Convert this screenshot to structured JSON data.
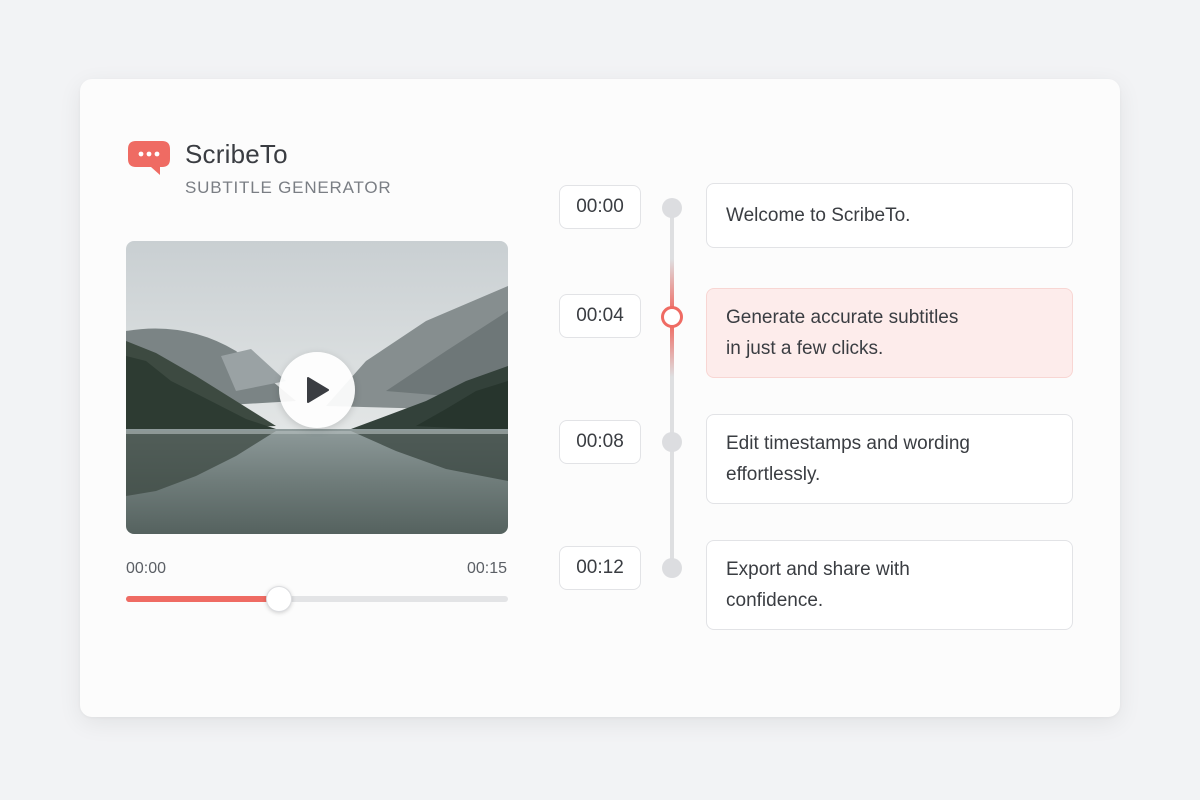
{
  "brand": {
    "name": "ScribeTo",
    "subtitle": "SUBTITLE GENERATOR",
    "icon": "chat-bubble-icon",
    "accent_color": "#ef6b63"
  },
  "player": {
    "current_time": "00:00",
    "duration": "00:15",
    "progress_fraction": 0.4,
    "play_icon": "play-icon"
  },
  "subtitles": [
    {
      "timestamp": "00:00",
      "text_lines": [
        "Welcome to ScribeTo."
      ],
      "active": false
    },
    {
      "timestamp": "00:04",
      "text_lines": [
        "Generate accurate subtitles",
        "in just a few clicks."
      ],
      "active": true
    },
    {
      "timestamp": "00:08",
      "text_lines": [
        "Edit timestamps and wording",
        "effortlessly."
      ],
      "active": false
    },
    {
      "timestamp": "00:12",
      "text_lines": [
        "Export and share with",
        "confidence."
      ],
      "active": false
    }
  ]
}
